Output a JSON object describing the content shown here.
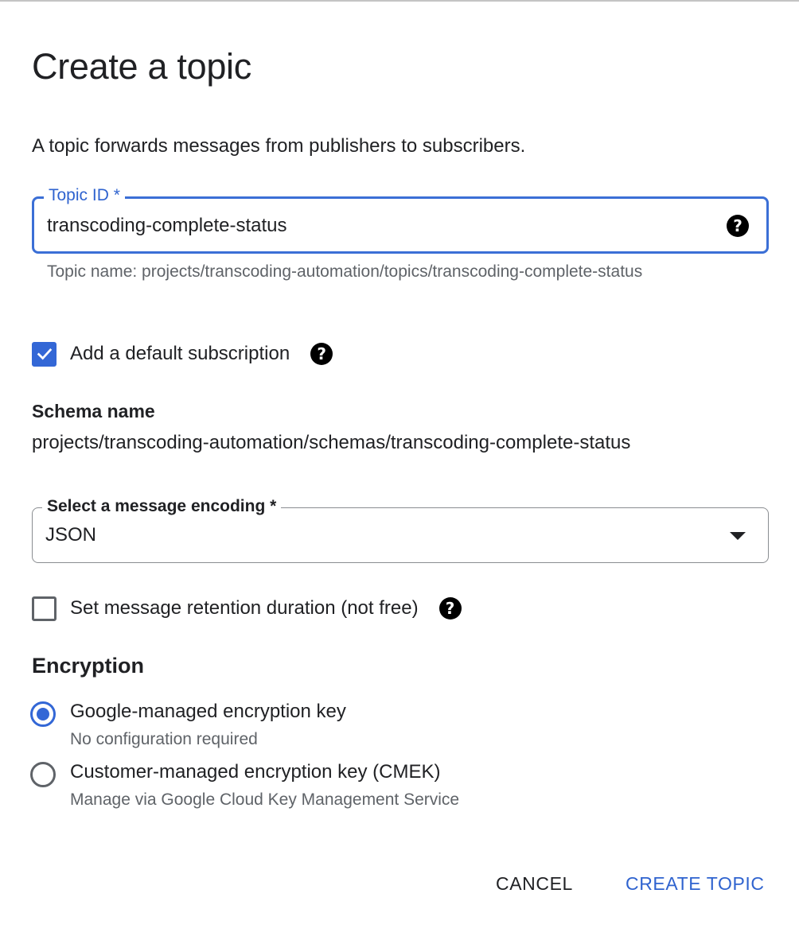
{
  "dialog": {
    "title": "Create a topic",
    "description": "A topic forwards messages from publishers to subscribers."
  },
  "topic_id": {
    "label": "Topic ID *",
    "value": "transcoding-complete-status",
    "help_icon": "help-icon",
    "hint": "Topic name: projects/transcoding-automation/topics/transcoding-complete-status"
  },
  "default_subscription": {
    "label": "Add a default subscription",
    "checked": true
  },
  "schema": {
    "heading": "Schema name",
    "path": "projects/transcoding-automation/schemas/transcoding-complete-status"
  },
  "encoding": {
    "label": "Select a message encoding *",
    "selected": "JSON"
  },
  "retention": {
    "label": "Set message retention duration (not free)",
    "checked": false
  },
  "encryption": {
    "heading": "Encryption",
    "options": [
      {
        "label": "Google-managed encryption key",
        "sub": "No configuration required",
        "selected": true
      },
      {
        "label": "Customer-managed encryption key (CMEK)",
        "sub": "Manage via Google Cloud Key Management Service",
        "selected": false
      }
    ]
  },
  "actions": {
    "cancel_label": "CANCEL",
    "create_label": "CREATE TOPIC"
  },
  "colors": {
    "accent": "#3367d6",
    "text": "#202124",
    "secondary_text": "#5f6368"
  }
}
